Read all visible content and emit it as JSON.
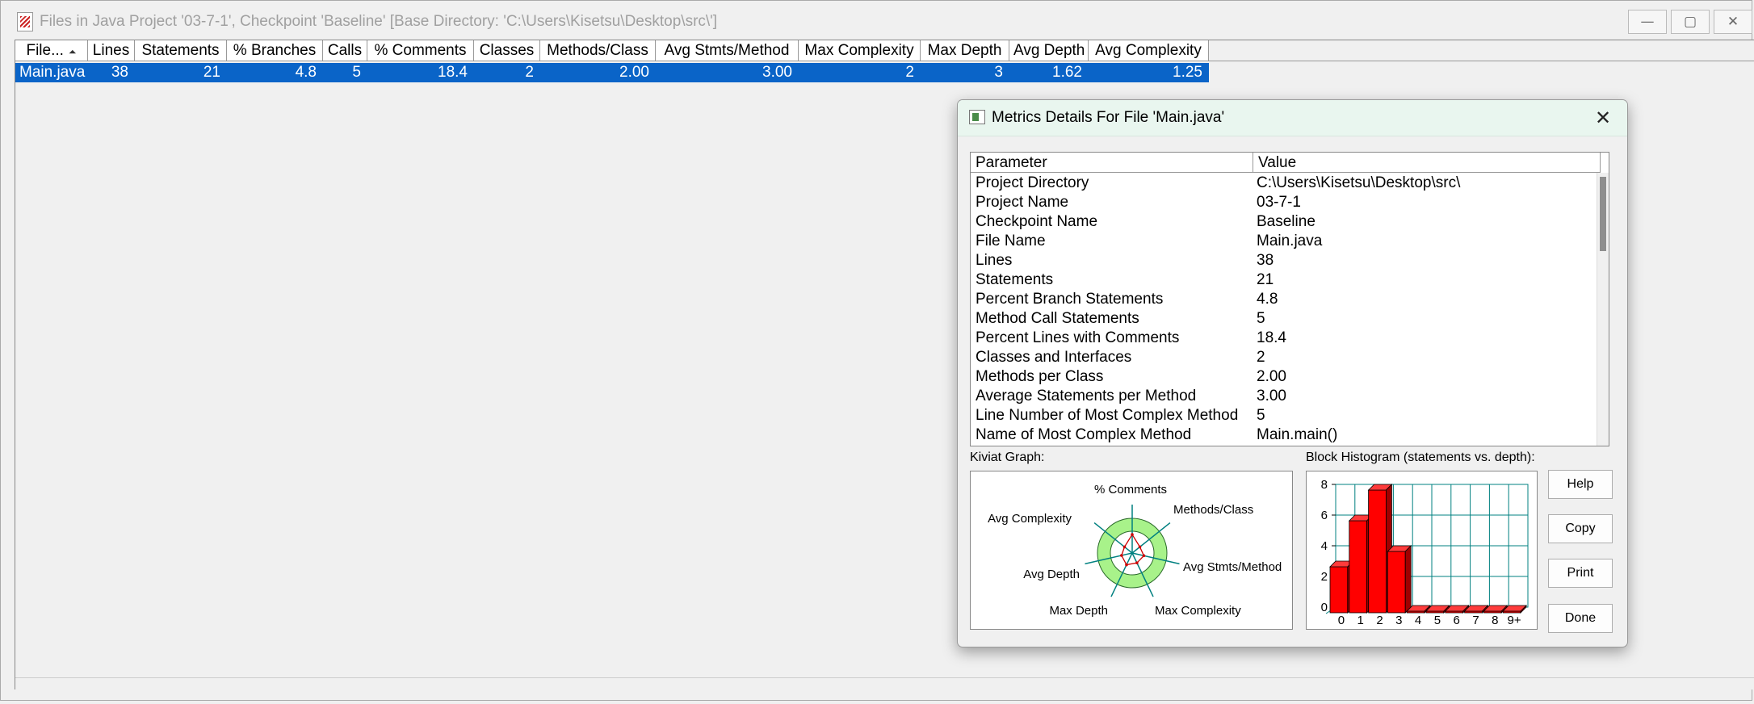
{
  "window": {
    "title": "Files in Java Project '03-7-1', Checkpoint 'Baseline'  [Base Directory: 'C:\\Users\\Kisetsu\\Desktop\\src\\']",
    "controls": {
      "minimize": "—",
      "maximize": "▢",
      "close": "✕"
    }
  },
  "file_table": {
    "columns": [
      "File...",
      "Lines",
      "Statements",
      "% Branches",
      "Calls",
      "% Comments",
      "Classes",
      "Methods/Class",
      "Avg Stmts/Method",
      "Max Complexity",
      "Max Depth",
      "Avg Depth",
      "Avg Complexity"
    ],
    "sort_indicator": "⏶",
    "rows": [
      [
        "Main.java",
        "38",
        "21",
        "4.8",
        "5",
        "18.4",
        "2",
        "2.00",
        "3.00",
        "2",
        "3",
        "1.62",
        "1.25"
      ]
    ]
  },
  "dialog": {
    "title": "Metrics Details For File 'Main.java'",
    "close": "✕",
    "param_header": "Parameter",
    "value_header": "Value",
    "params": [
      [
        "Project Directory",
        "C:\\Users\\Kisetsu\\Desktop\\src\\"
      ],
      [
        "Project Name",
        "03-7-1"
      ],
      [
        "Checkpoint Name",
        "Baseline"
      ],
      [
        "File Name",
        "Main.java"
      ],
      [
        "Lines",
        "38"
      ],
      [
        "Statements",
        "21"
      ],
      [
        "Percent Branch Statements",
        "4.8"
      ],
      [
        "Method Call Statements",
        "5"
      ],
      [
        "Percent Lines with Comments",
        "18.4"
      ],
      [
        "Classes and Interfaces",
        "2"
      ],
      [
        "Methods per Class",
        "2.00"
      ],
      [
        "Average Statements per Method",
        "3.00"
      ],
      [
        "Line Number of Most Complex Method",
        "5"
      ],
      [
        "Name of Most Complex Method",
        "Main.main()"
      ]
    ],
    "kiviat_label": "Kiviat Graph:",
    "histogram_label": "Block Histogram (statements vs. depth):",
    "buttons": {
      "help": "Help",
      "copy": "Copy",
      "print": "Print",
      "done": "Done"
    }
  },
  "kiviat": {
    "axes": [
      "% Comments",
      "Methods/Class",
      "Avg Stmts/Method",
      "Max Complexity",
      "Max Depth",
      "Avg Depth",
      "Avg Complexity"
    ],
    "colors": {
      "outer_ring": "#a8f28a",
      "inner_circle": "#ffffff",
      "axis": "#008080",
      "polygon": "#cc0000"
    }
  },
  "histogram": {
    "type": "bar",
    "categories": [
      "0",
      "1",
      "2",
      "3",
      "4",
      "5",
      "6",
      "7",
      "8",
      "9+"
    ],
    "values": [
      3,
      6,
      8,
      4,
      0,
      0,
      0,
      0,
      0,
      0
    ],
    "yticks": [
      "0",
      "2",
      "4",
      "6",
      "8"
    ],
    "ylim": [
      0,
      8
    ],
    "colors": {
      "bar": "#ff0000",
      "bar_top": "#ff3b3b",
      "bar_side": "#a00000",
      "grid": "#008080"
    }
  }
}
